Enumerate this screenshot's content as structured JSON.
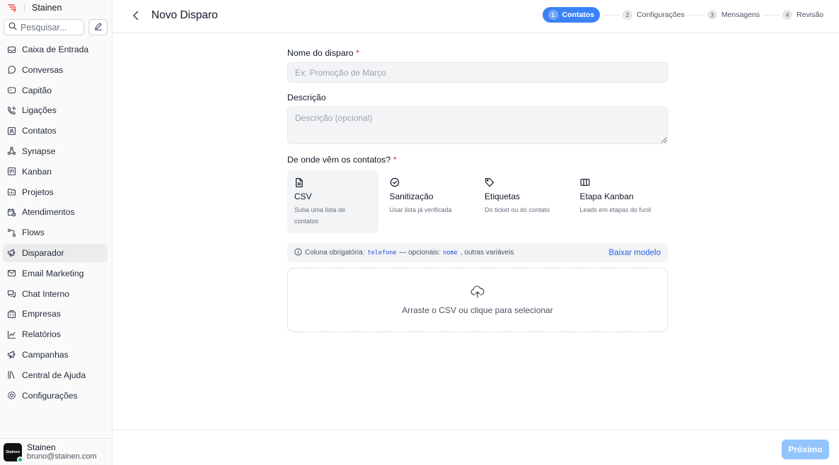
{
  "brand": {
    "name": "Stainen"
  },
  "search": {
    "placeholder": "Pesquisar..."
  },
  "sidebar": {
    "items": [
      {
        "label": "Caixa de Entrada",
        "icon": "inbox-icon"
      },
      {
        "label": "Conversas",
        "icon": "chat-bubble-icon"
      },
      {
        "label": "Capitão",
        "icon": "robot-icon"
      },
      {
        "label": "Ligações",
        "icon": "phone-icon"
      },
      {
        "label": "Contatos",
        "icon": "contact-card-icon"
      },
      {
        "label": "Synapse",
        "icon": "network-icon"
      },
      {
        "label": "Kanban",
        "icon": "kanban-icon"
      },
      {
        "label": "Projetos",
        "icon": "folder-icon"
      },
      {
        "label": "Atendimentos",
        "icon": "calendar-clock-icon"
      },
      {
        "label": "Flows",
        "icon": "flow-icon"
      },
      {
        "label": "Disparador",
        "icon": "megaphone-icon",
        "active": true
      },
      {
        "label": "Email Marketing",
        "icon": "mail-icon"
      },
      {
        "label": "Chat Interno",
        "icon": "chat-double-icon"
      },
      {
        "label": "Empresas",
        "icon": "building-icon"
      },
      {
        "label": "Relatórios",
        "icon": "line-chart-icon"
      },
      {
        "label": "Campanhas",
        "icon": "megaphone-icon"
      },
      {
        "label": "Central de Ajuda",
        "icon": "books-icon"
      },
      {
        "label": "Configurações",
        "icon": "gear-icon"
      }
    ]
  },
  "user": {
    "name": "Stainen",
    "email": "bruno@stainen.com",
    "avatar_text": "Stainen"
  },
  "header": {
    "title": "Novo Disparo",
    "steps": [
      {
        "num": "1",
        "label": "Contatos",
        "active": true
      },
      {
        "num": "2",
        "label": "Configurações"
      },
      {
        "num": "3",
        "label": "Mensagens"
      },
      {
        "num": "4",
        "label": "Revisão"
      }
    ]
  },
  "form": {
    "name_label": "Nome do disparo",
    "name_placeholder": "Ex: Promoção de Março",
    "desc_label": "Descrição",
    "desc_placeholder": "Descrição (opcional)",
    "source_label": "De onde vêm os contatos?",
    "required_mark": "*",
    "sources": [
      {
        "name": "CSV",
        "desc": "Suba uma lista de contatos",
        "icon": "file-icon",
        "selected": true
      },
      {
        "name": "Sanitização",
        "desc": "Usar lista já verificada",
        "icon": "check-circle-icon"
      },
      {
        "name": "Etiquetas",
        "desc": "Do ticket ou do contato",
        "icon": "tag-icon"
      },
      {
        "name": "Etapa Kanban",
        "desc": "Leads em etapas do funil",
        "icon": "columns-icon"
      }
    ],
    "info": {
      "prefix": "Coluna obrigatória:",
      "required_col": "telefone",
      "middle": "— opcionais:",
      "optional_col": "nome",
      "suffix": ", outras variáveis",
      "download": "Baixar modelo"
    },
    "dropzone_text": "Arraste o CSV ou clique para selecionar"
  },
  "footer": {
    "next_label": "Próximo"
  },
  "colors": {
    "accent": "#3b82f6",
    "accent_disabled": "#93c5fd",
    "required": "#dc2626",
    "brand": "#ef4444"
  }
}
